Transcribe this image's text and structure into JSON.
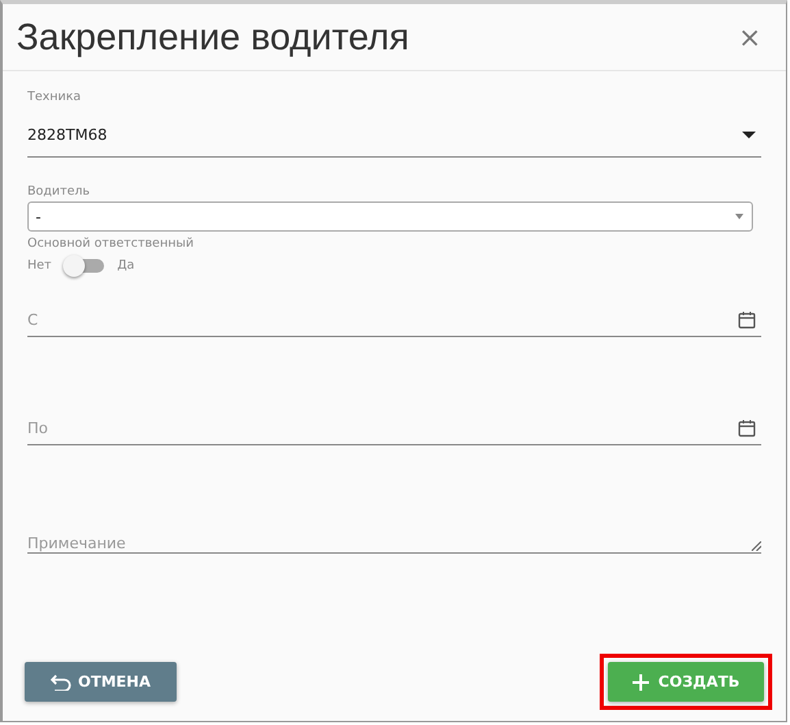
{
  "dialog": {
    "title": "Закрепление водителя",
    "close": "×"
  },
  "fields": [
    {
      "kind": "dropdown",
      "label": "Техника",
      "value": "2828ТМ68"
    },
    {
      "kind": "select",
      "label": "Водитель",
      "value": "-"
    },
    {
      "kind": "toggle",
      "label": "Основной ответственный",
      "off_label": "Нет",
      "on_label": "Да",
      "on": false
    },
    {
      "kind": "date",
      "placeholder": "С"
    },
    {
      "kind": "date",
      "placeholder": "По"
    },
    {
      "kind": "textarea",
      "placeholder": "Примечание"
    }
  ],
  "buttons": [
    {
      "kind": "cancel",
      "label": "ОТМЕНА",
      "highlighted": false
    },
    {
      "kind": "create",
      "label": "СОЗДАТЬ",
      "highlighted": true
    }
  ]
}
